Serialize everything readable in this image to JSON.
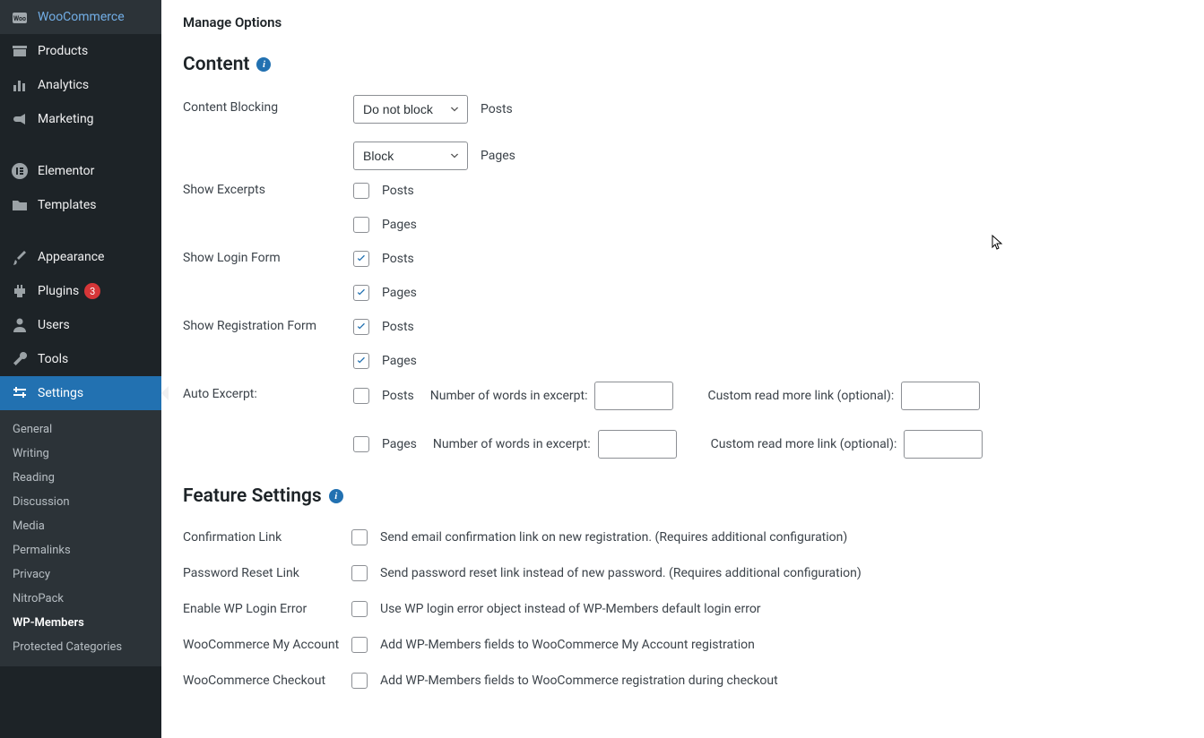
{
  "sidebar": {
    "items": [
      {
        "label": "WooCommerce"
      },
      {
        "label": "Products"
      },
      {
        "label": "Analytics"
      },
      {
        "label": "Marketing"
      },
      {
        "label": "Elementor"
      },
      {
        "label": "Templates"
      },
      {
        "label": "Appearance"
      },
      {
        "label": "Plugins",
        "badge": "3"
      },
      {
        "label": "Users"
      },
      {
        "label": "Tools"
      },
      {
        "label": "Settings"
      }
    ],
    "submenu": [
      {
        "label": "General"
      },
      {
        "label": "Writing"
      },
      {
        "label": "Reading"
      },
      {
        "label": "Discussion"
      },
      {
        "label": "Media"
      },
      {
        "label": "Permalinks"
      },
      {
        "label": "Privacy"
      },
      {
        "label": "NitroPack"
      },
      {
        "label": "WP-Members"
      },
      {
        "label": "Protected Categories"
      }
    ]
  },
  "page": {
    "breadcrumb": "Manage Options",
    "content_section": "Content",
    "feature_section": "Feature Settings"
  },
  "content": {
    "blocking_label": "Content Blocking",
    "blocking_posts_select": "Do not block",
    "blocking_posts_suffix": "Posts",
    "blocking_pages_select": "Block",
    "blocking_pages_suffix": "Pages",
    "excerpts_label": "Show Excerpts",
    "login_label": "Show Login Form",
    "registration_label": "Show Registration Form",
    "auto_excerpt_label": "Auto Excerpt:",
    "posts_text": "Posts",
    "pages_text": "Pages",
    "words_label": "Number of words in excerpt:",
    "readmore_label": "Custom read more link (optional):"
  },
  "features": {
    "rows": [
      {
        "label": "Confirmation Link",
        "desc": "Send email confirmation link on new registration. (Requires additional configuration)"
      },
      {
        "label": "Password Reset Link",
        "desc": "Send password reset link instead of new password. (Requires additional configuration)"
      },
      {
        "label": "Enable WP Login Error",
        "desc": "Use WP login error object instead of WP-Members default login error"
      },
      {
        "label": "WooCommerce My Account",
        "desc": "Add WP-Members fields to WooCommerce My Account registration"
      },
      {
        "label": "WooCommerce Checkout",
        "desc": "Add WP-Members fields to WooCommerce registration during checkout"
      }
    ]
  }
}
